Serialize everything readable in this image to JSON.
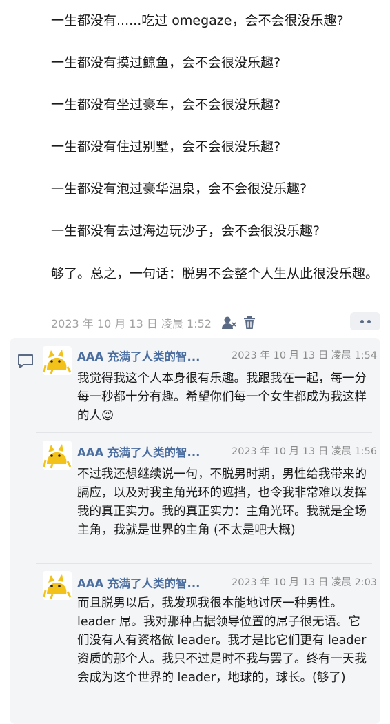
{
  "post": {
    "lines": [
      "一生都没有......吃过 omegaze，会不会很没乐趣?",
      "一生都没有摸过鲸鱼，会不会很没乐趣?",
      "一生都没有坐过豪车，会不会很没乐趣?",
      "一生都没有住过别墅，会不会很没乐趣?",
      "一生都没有泡过豪华温泉，会不会很没乐趣?",
      "一生都没有去过海边玩沙子，会不会很没乐趣?"
    ],
    "final": "够了。总之，一句话：脱男不会整个人生从此很没乐趣。",
    "timestamp": "2023 年 10 月 13 日 凌晨 1:52"
  },
  "comments": [
    {
      "name": "AAA 充满了人类的智...",
      "time": "2023 年 10 月 13 日 凌晨 1:54",
      "text": "我觉得我这个人本身很有乐趣。我跟我在一起，每一分每一秒都十分有趣。希望你们每一个女生都成为我这样的人😌"
    },
    {
      "name": "AAA 充满了人类的智...",
      "time": "2023 年 10 月 13 日 凌晨 1:56",
      "text": "不过我还想继续说一句，不脱男时期，男性给我带来的膈应，以及对我主角光环的遮挡，也令我非常难以发挥我的真正实力。我的真正实力：主角光环。我就是全场主角，我就是世界的主角 (不太是吧大概)"
    },
    {
      "name": "AAA 充满了人类的智...",
      "time": "2023 年 10 月 13 日 凌晨 2:03",
      "text": "而且脱男以后，我发现我很本能地讨厌一种男性。leader 屌。我对那种占据领导位置的屌子很无语。它们没有人有资格做 leader。我才是比它们更有 leader 资质的那个人。我只不过是时不我与罢了。终有一天我会成为这个世界的 leader，地球的，球长。(够了)"
    }
  ],
  "icons": {
    "person": "person-icon",
    "trash": "trash-icon",
    "more": "more-icon",
    "comment": "comment-icon",
    "avatar": "cat-avatar"
  },
  "colors": {
    "accent": "#4a6da0",
    "icon": "#5a6a85",
    "muted": "#a3a3a3",
    "panel": "#f4f5f7"
  }
}
